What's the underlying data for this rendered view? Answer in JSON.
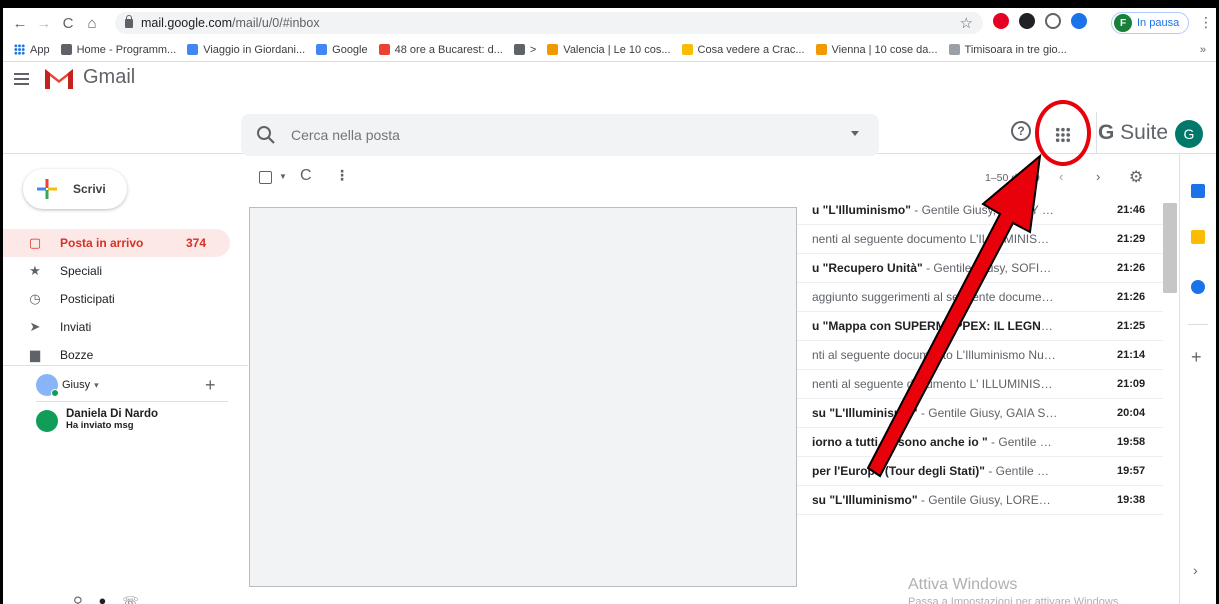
{
  "browser": {
    "url_host": "mail.google.com",
    "url_path": "/mail/u/0/#inbox",
    "profile_initial": "F",
    "profile_status": "In pausa"
  },
  "bookmarks": [
    {
      "label": "App",
      "color": "#1a73e8"
    },
    {
      "label": "Home - Programm...",
      "color": "#5f6368"
    },
    {
      "label": "Viaggio in Giordani...",
      "color": "#4285f4"
    },
    {
      "label": "Google",
      "color": "#4285f4"
    },
    {
      "label": "48 ore a Bucarest: d...",
      "color": "#ea4335"
    },
    {
      "label": ">",
      "color": "#5f6368"
    },
    {
      "label": "Valencia | Le 10 cos...",
      "color": "#f29900"
    },
    {
      "label": "Cosa vedere a Crac...",
      "color": "#fbbc04"
    },
    {
      "label": "Vienna | 10 cose da...",
      "color": "#f29900"
    },
    {
      "label": "Timisoara in tre gio...",
      "color": "#9aa0a6"
    }
  ],
  "bookmarks_more": "»",
  "gmail": {
    "title": "Gmail",
    "search_placeholder": "Cerca nella posta",
    "gsuite_g": "G",
    "gsuite_rest": " Suite",
    "user_initial": "G"
  },
  "compose_label": "Scrivi",
  "nav": [
    {
      "label": "Posta in arrivo",
      "count": "374",
      "icon": "inbox-icon",
      "glyph": "▢",
      "active": true
    },
    {
      "label": "Speciali",
      "count": "",
      "icon": "star-icon",
      "glyph": "★",
      "active": false
    },
    {
      "label": "Posticipati",
      "count": "",
      "icon": "clock-icon",
      "glyph": "◷",
      "active": false
    },
    {
      "label": "Inviati",
      "count": "",
      "icon": "send-icon",
      "glyph": "➤",
      "active": false
    },
    {
      "label": "Bozze",
      "count": "",
      "icon": "draft-icon",
      "glyph": "▆",
      "active": false
    }
  ],
  "hangouts": {
    "user": "Giusy",
    "contact_name": "Daniela Di Nardo",
    "contact_status": "Ha inviato msg"
  },
  "toolbar": {
    "pager": "1–50 di 439"
  },
  "mails": [
    {
      "subject_bold": "u \"L'Illuminismo\"",
      "subject_rest": " - Gentile Giusy, JENNY MO...",
      "time": "21:46"
    },
    {
      "subject_bold": "",
      "subject_rest": "nenti al seguente documento L'ILLUMINISMO...",
      "time": "21:29"
    },
    {
      "subject_bold": "u \"Recupero Unità\"",
      "subject_rest": " - Gentile Giusy, SOFIA CR...",
      "time": "21:26"
    },
    {
      "subject_bold": "",
      "subject_rest": "aggiunto suggerimenti al seguente documen...",
      "time": "21:26"
    },
    {
      "subject_bold": "u \"Mappa con SUPERMAPPEX: IL LEGNO\"",
      "subject_rest": " - G...",
      "time": "21:25"
    },
    {
      "subject_bold": "",
      "subject_rest": "nti al seguente documento L'Illuminismo Nuo...",
      "time": "21:14"
    },
    {
      "subject_bold": "",
      "subject_rest": "nenti al seguente documento L' ILLUMINISM...",
      "time": "21:09"
    },
    {
      "subject_bold": "su \"L'Illuminismo\"",
      "subject_rest": " - Gentile Giusy, GAIA SAN...",
      "time": "20:04"
    },
    {
      "subject_bold": "iorno a tutti, ci sono anche io \"",
      "subject_rest": " - Gentile Giu...",
      "time": "19:58"
    },
    {
      "subject_bold": "per l'Europa (Tour degli Stati)\"",
      "subject_rest": " - Gentile Giu...",
      "time": "19:57"
    },
    {
      "subject_bold": "su \"L'Illuminismo\"",
      "subject_rest": " - Gentile Giusy, LORENZO ...",
      "time": "19:38"
    }
  ],
  "watermark": {
    "title": "Attiva Windows",
    "subtitle": "Passa a Impostazioni per attivare Windows."
  },
  "colors": {
    "annotation": "#e8000b",
    "inbox_active_bg": "#fce8e6",
    "inbox_active_text": "#d93025"
  }
}
